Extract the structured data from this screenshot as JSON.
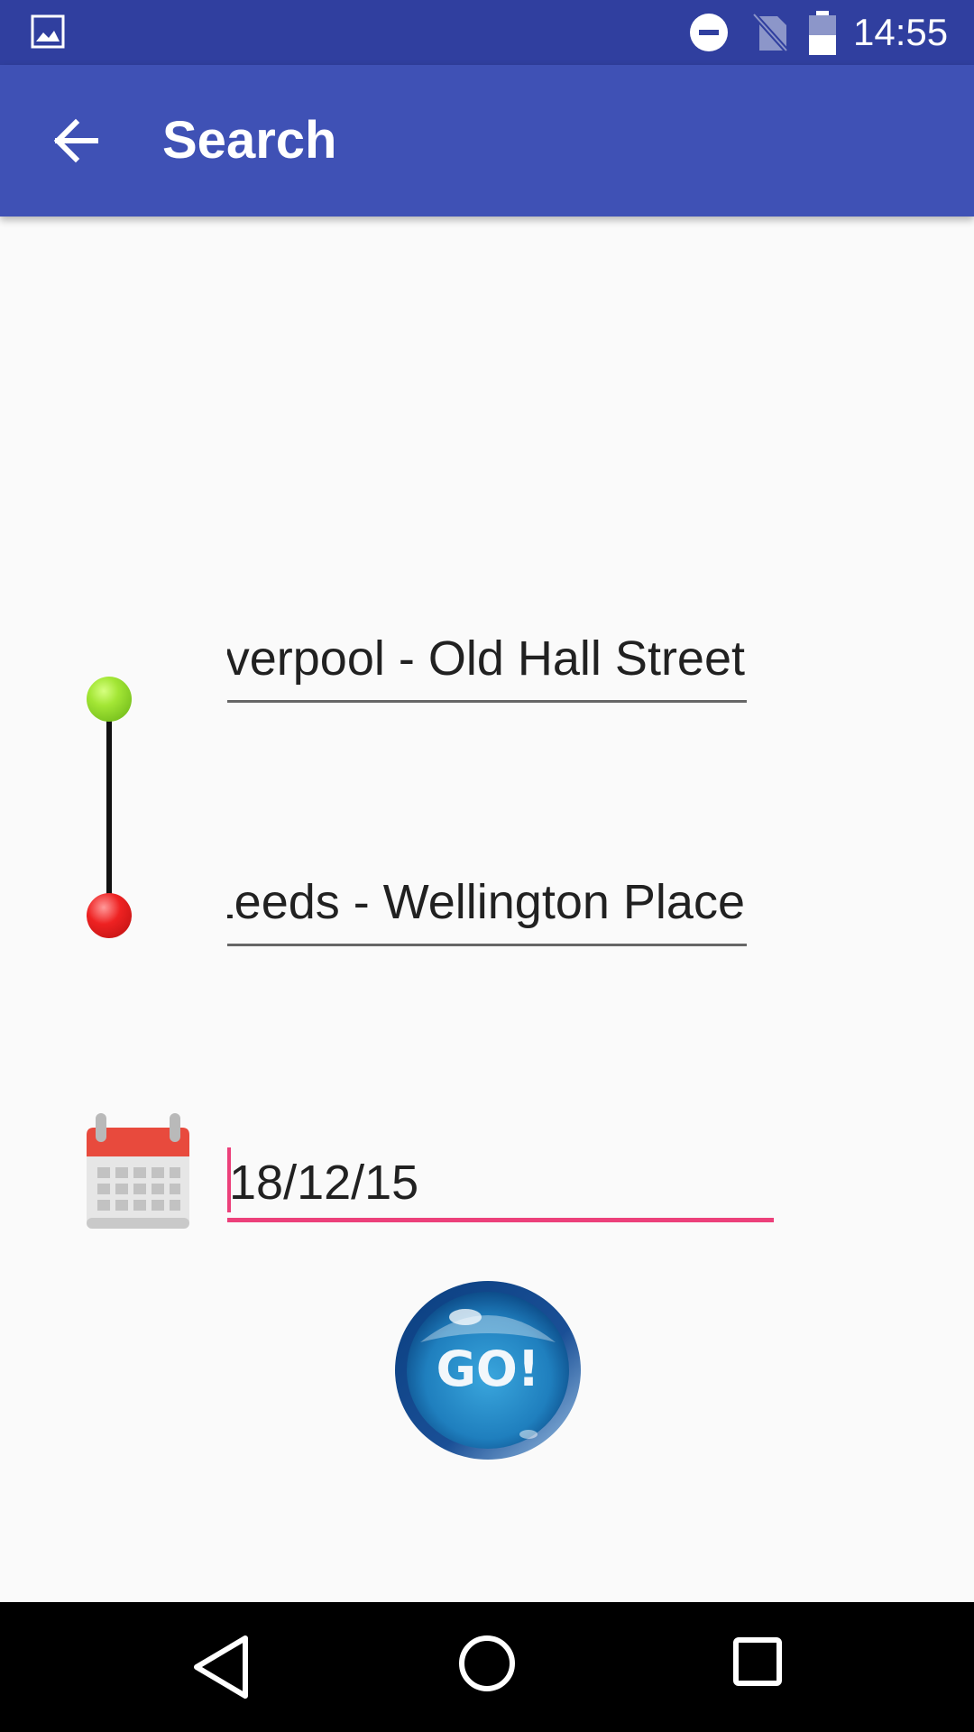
{
  "status_bar": {
    "time": "14:55",
    "icons": [
      "image-icon",
      "do-not-disturb-icon",
      "no-sim-icon",
      "battery-icon"
    ]
  },
  "app_bar": {
    "title": "Search",
    "back_icon": "arrow-back-icon",
    "color": "#3f51b5"
  },
  "search": {
    "from_value": "Liverpool - Old Hall Street",
    "to_value": "Leeds - Wellington Place",
    "date_value": "18/12/15",
    "go_label": "GO!",
    "start_marker_color": "#8edb2a",
    "end_marker_color": "#e52222",
    "date_icon": "calendar-icon"
  },
  "nav_bar": {
    "icons": [
      "back-triangle-icon",
      "home-circle-icon",
      "recents-square-icon"
    ]
  },
  "colors": {
    "status_bar": "#303f9f",
    "accent": "#ec407a",
    "background": "#fafafa"
  }
}
